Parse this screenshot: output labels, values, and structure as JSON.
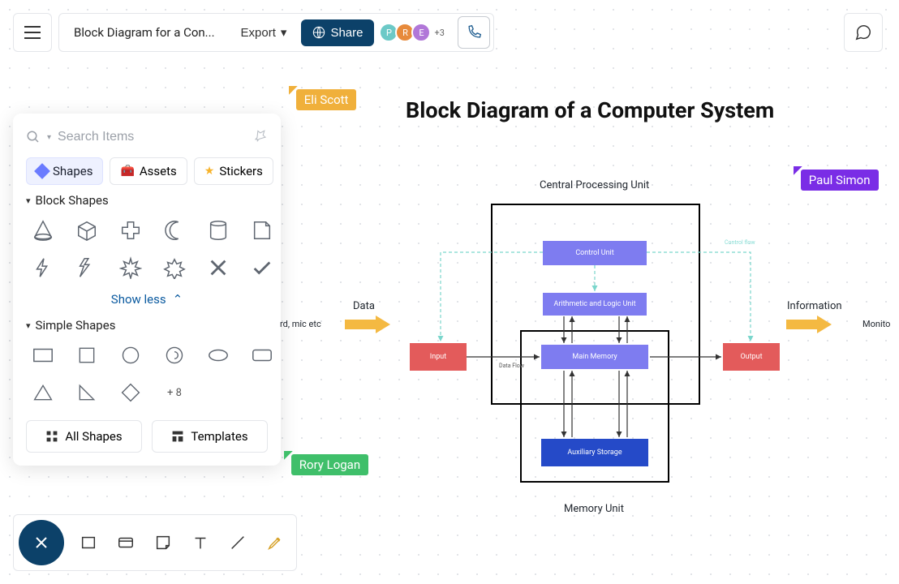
{
  "topbar": {
    "doc_title": "Block Diagram for a Con...",
    "export_label": "Export",
    "share_label": "Share",
    "avatars": [
      "P",
      "R",
      "E"
    ],
    "more_count": "+3"
  },
  "panel": {
    "search_placeholder": "Search Items",
    "tabs": {
      "shapes": "Shapes",
      "assets": "Assets",
      "stickers": "Stickers"
    },
    "section_block": "Block Shapes",
    "section_simple": "Simple Shapes",
    "show_less": "Show less",
    "plus_more": "+ 8",
    "all_shapes": "All Shapes",
    "templates": "Templates"
  },
  "cursors": {
    "eli": "Eli Scott",
    "paul": "Paul Simon",
    "rory": "Rory Logan"
  },
  "diagram": {
    "title": "Block Diagram of a Computer System",
    "labels": {
      "cpu": "Central Processing Unit",
      "memory": "Memory Unit",
      "data": "Data",
      "info": "Information",
      "keyboard": "rd, mic etc",
      "monitor": "Monito",
      "control_flow": "Control flow",
      "data_flow": "Data Flow"
    },
    "boxes": {
      "control": "Control Unit",
      "alu": "Arithmetic and Logic Unit",
      "main_mem": "Main Memory",
      "input": "Input",
      "output": "Output",
      "aux": "Auxiliary Storage"
    }
  }
}
